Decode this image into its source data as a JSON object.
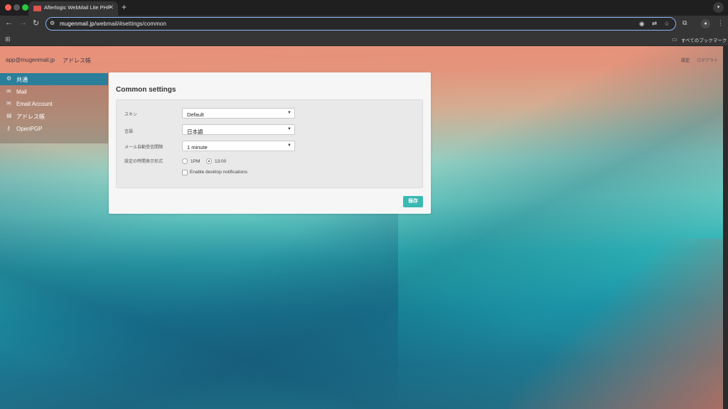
{
  "browser": {
    "tab_title": "Afterlogic WebMail Lite PHP",
    "tab_close": "✕",
    "new_tab": "+",
    "url_domain": "mugenmail.jp",
    "url_path": "/webmail/#settings/common",
    "bookmarks_folder_label": "すべてのブックマーク"
  },
  "app": {
    "account": "app@mugenmail.jp",
    "contacts_link": "アドレス帳",
    "settings_link": "設定",
    "logout_link": "ログアウト"
  },
  "sidebar": {
    "items": [
      {
        "label": "共通",
        "icon": "gear-icon",
        "active": true
      },
      {
        "label": "Mail",
        "icon": "envelope-icon",
        "active": false
      },
      {
        "label": "Email Account",
        "icon": "envelope-icon",
        "active": false
      },
      {
        "label": "アドレス帳",
        "icon": "contacts-icon",
        "active": false
      },
      {
        "label": "OpenPGP",
        "icon": "key-icon",
        "active": false
      }
    ]
  },
  "settings": {
    "title": "Common settings",
    "skin_label": "スキン",
    "skin_value": "Default",
    "language_label": "言語",
    "language_value": "日本語",
    "autocheck_label": "メール自動受信間隔",
    "autocheck_value": "1 minute",
    "timeformat_label": "設定の時間表示形式",
    "time_option_12": "1PM",
    "time_option_24": "13:00",
    "time_selected": "13:00",
    "desktop_notifications_label": "Enable desktop notifications",
    "desktop_notifications_checked": false,
    "save_label": "保存"
  },
  "colors": {
    "accent": "#3ab9b2",
    "sidebar_active": "#2b7f9a"
  }
}
